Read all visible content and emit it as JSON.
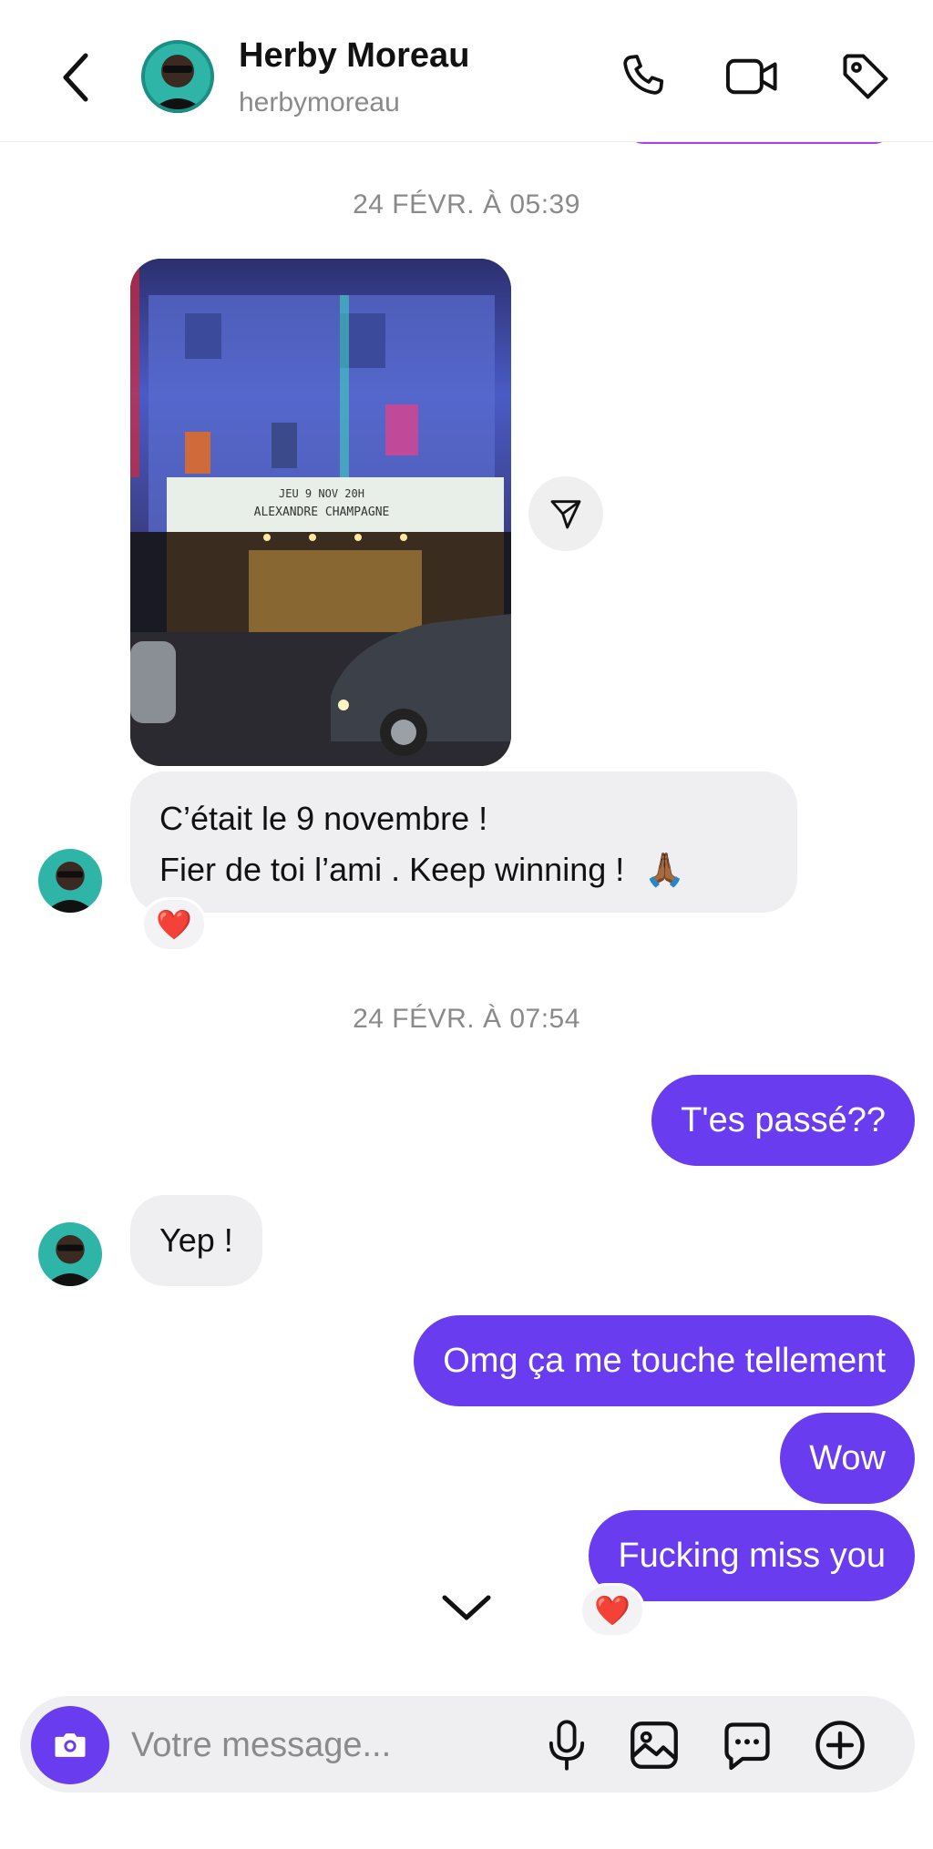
{
  "header": {
    "name": "Herby Moreau",
    "handle": "herbymoreau"
  },
  "conversation": {
    "timestamp_1": "24 FÉVR. À 05:39",
    "photo_marquee_line1": "JEU 9 NOV 20H",
    "photo_marquee_line2": "ALEXANDRE CHAMPAGNE",
    "incoming_1_line1": "C’était le 9 novembre !",
    "incoming_1_line2": " Fier de toi l’ami . Keep winning !",
    "incoming_1_emoji": "🙏🏾",
    "reaction_emoji": "❤️",
    "timestamp_2": "24 FÉVR. À 07:54",
    "outgoing_1": "T'es passé??",
    "incoming_2": "Yep !",
    "outgoing_2": "Omg ça me touche tellement",
    "outgoing_3": "Wow",
    "outgoing_4": "Fucking miss you"
  },
  "composer": {
    "placeholder": "Votre message..."
  },
  "colors": {
    "accent": "#6a3cf0",
    "incoming_bubble": "#efeff1",
    "timestamp": "#8a8a8a"
  },
  "icons": [
    "back-chevron-icon",
    "phone-icon",
    "video-camera-icon",
    "tag-icon",
    "send-share-icon",
    "chevron-down-icon",
    "camera-icon",
    "microphone-icon",
    "image-gallery-icon",
    "sticker-chat-icon",
    "plus-circle-icon"
  ]
}
